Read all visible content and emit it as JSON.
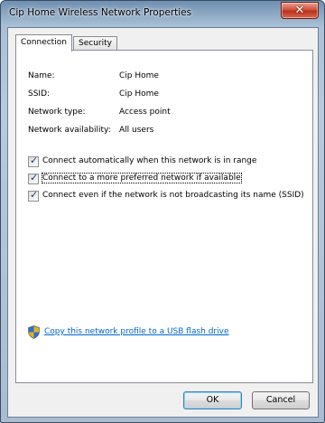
{
  "window": {
    "title": "Cip Home Wireless Network Properties",
    "close_glyph": "✕"
  },
  "tabs": [
    {
      "label": "Connection",
      "active": true
    },
    {
      "label": "Security",
      "active": false
    }
  ],
  "info": [
    {
      "label": "Name:",
      "value": "Cip Home"
    },
    {
      "label": "SSID:",
      "value": "Cip Home"
    },
    {
      "label": "Network type:",
      "value": "Access point"
    },
    {
      "label": "Network availability:",
      "value": "All users"
    }
  ],
  "options": [
    {
      "label": "Connect automatically when this network is in range",
      "checked": true
    },
    {
      "label": "Connect to a more preferred network if available",
      "checked": true
    },
    {
      "label": "Connect even if the network is not broadcasting its name (SSID)",
      "checked": true
    }
  ],
  "check_mark": "✓",
  "link": {
    "text": "Copy this network profile to a USB flash drive",
    "icon": "uac-shield-icon"
  },
  "buttons": {
    "ok": "OK",
    "cancel": "Cancel"
  },
  "colors": {
    "link": "#0066cc",
    "close_button": "#c8422a",
    "title_bar": "#a9c0d6"
  }
}
